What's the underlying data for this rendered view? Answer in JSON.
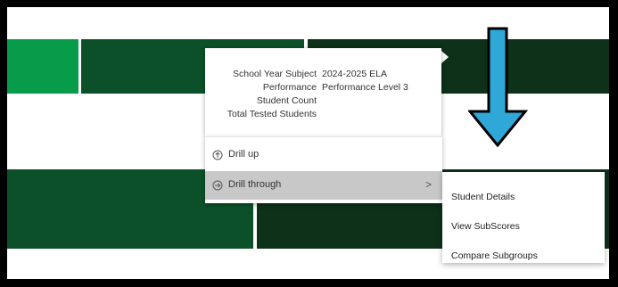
{
  "colors": {
    "light_green": "#079c4a",
    "mid_green": "#0c5029",
    "dark_green": "#0d3119",
    "arrow_blue": "#2fa8d8"
  },
  "tooltip": {
    "rows": [
      {
        "key": "School Year Subject",
        "value": "2024-2025 ELA"
      },
      {
        "key": "Performance",
        "value": "Performance Level 3"
      },
      {
        "key": "Student Count",
        "value": ""
      },
      {
        "key": "Total Tested Students",
        "value": ""
      }
    ]
  },
  "context_menu": {
    "drill_up": {
      "label": "Drill up",
      "icon": "drill-up-icon"
    },
    "drill_through": {
      "label": "Drill through",
      "icon": "drill-through-icon",
      "chevron": ">"
    }
  },
  "submenu": {
    "items": [
      "Student Details",
      "View SubScores",
      "Compare Subgroups"
    ]
  },
  "annotation": {
    "icon": "down-arrow-icon"
  }
}
